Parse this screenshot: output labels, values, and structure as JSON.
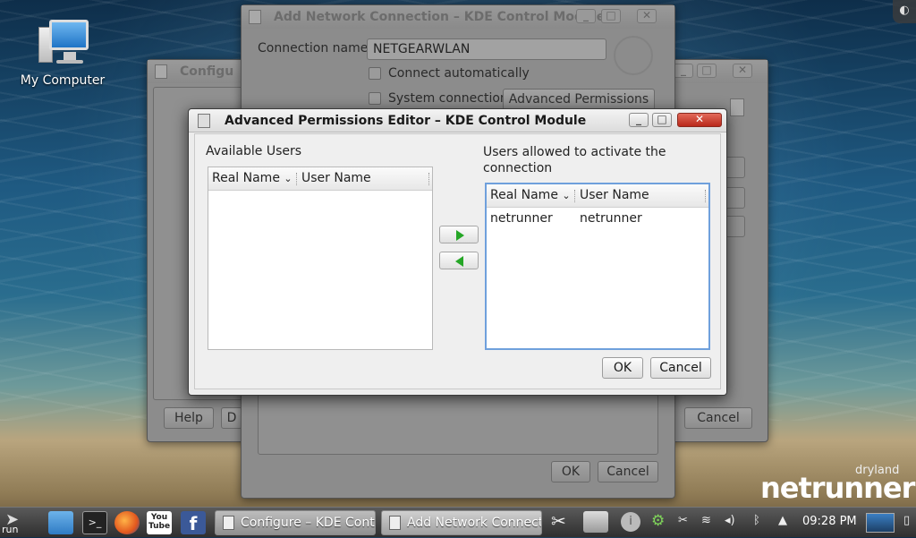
{
  "desktop": {
    "icon_label": "My Computer"
  },
  "windows": {
    "configure": {
      "title": "Configure – KDE Control Module",
      "title_visible": "Configu",
      "help_label": "Help",
      "partial_label": "D",
      "cancel_label": "Cancel"
    },
    "add_connection": {
      "title": "Add Network Connection – KDE Control Module",
      "connection_name_label": "Connection name:",
      "connection_name_value": "NETGEARWLAN",
      "connect_auto_label": "Connect automatically",
      "system_connection_label": "System connection",
      "advanced_permissions_label": "Advanced Permissions",
      "ok_label": "OK",
      "cancel_label": "Cancel"
    }
  },
  "dialog": {
    "title": "Advanced Permissions Editor – KDE Control Module",
    "available_users_label": "Available Users",
    "allowed_users_label_line1": "Users allowed to activate the",
    "allowed_users_label_line2": "connection",
    "columns": {
      "real_name": "Real Name",
      "user_name": "User Name"
    },
    "allowed_rows": [
      {
        "real_name": "netrunner",
        "user_name": "netrunner"
      }
    ],
    "ok_label": "OK",
    "cancel_label": "Cancel"
  },
  "taskbar": {
    "start_label": "run",
    "tasks": [
      {
        "label": "Configure – KDE Contr"
      },
      {
        "label": "Add Network Connectio"
      }
    ],
    "clock": "09:28 PM",
    "youtube_label": "You Tube",
    "facebook_label": "f"
  },
  "branding": {
    "small": "dryland",
    "big": "netrunner"
  },
  "colors": {
    "accent_green": "#25a626",
    "focus_blue": "#6fa0dc",
    "close_red": "#c0392b"
  }
}
